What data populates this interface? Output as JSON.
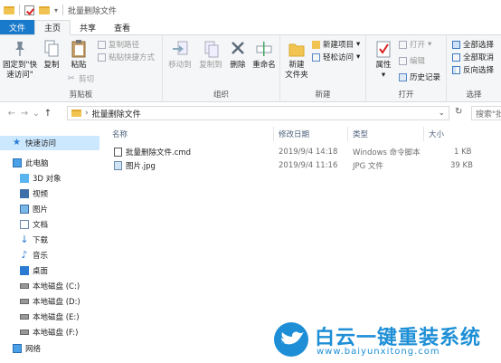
{
  "window": {
    "title": "批量删除文件"
  },
  "tabs": [
    {
      "label": "文件"
    },
    {
      "label": "主页"
    },
    {
      "label": "共享"
    },
    {
      "label": "查看"
    }
  ],
  "ribbon": {
    "clipboard": {
      "label": "剪贴板",
      "pin_label_1": "固定到\"快",
      "pin_label_2": "速访问\"",
      "copy": "复制",
      "paste": "粘贴",
      "copy_path": "复制路径",
      "paste_shortcut": "粘贴快捷方式",
      "cut": "剪切"
    },
    "organize": {
      "label": "组织",
      "move_to": "移动到",
      "copy_to": "复制到",
      "delete": "删除",
      "rename": "重命名"
    },
    "new": {
      "label": "新建",
      "new_folder_1": "新建",
      "new_folder_2": "文件夹",
      "new_item": "新建项目",
      "easy_access": "轻松访问"
    },
    "open": {
      "label": "打开",
      "properties": "属性",
      "open": "打开",
      "edit": "编辑",
      "history": "历史记录"
    },
    "select": {
      "label": "选择",
      "select_all": "全部选择",
      "select_none": "全部取消",
      "invert": "反向选择"
    }
  },
  "address": {
    "path": "批量删除文件",
    "search_placeholder": "搜索\"批"
  },
  "nav": {
    "quick_access": "快速访问",
    "this_pc": "此电脑",
    "items": [
      "3D 对象",
      "视频",
      "图片",
      "文档",
      "下载",
      "音乐",
      "桌面",
      "本地磁盘 (C:)",
      "本地磁盘 (D:)",
      "本地磁盘 (E:)",
      "本地磁盘 (F:)"
    ],
    "network": "网络"
  },
  "columns": {
    "name": "名称",
    "date": "修改日期",
    "type": "类型",
    "size": "大小"
  },
  "files": [
    {
      "name": "批量删除文件.cmd",
      "date": "2019/9/4 14:18",
      "type": "Windows 命令脚本",
      "size": "1 KB"
    },
    {
      "name": "图片.jpg",
      "date": "2019/9/4 11:16",
      "type": "JPG 文件",
      "size": "39 KB"
    }
  ],
  "watermark": {
    "title": "白云一键重装系统",
    "url": "www.baiyunxitong.com",
    "color": "#1e8fd6"
  }
}
